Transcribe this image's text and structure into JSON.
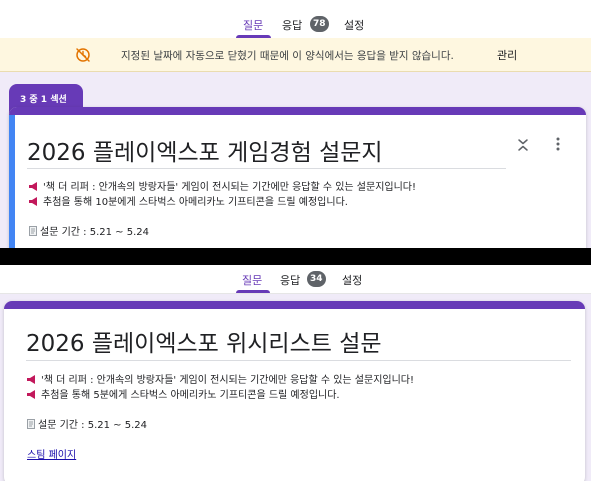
{
  "form1": {
    "tabs": {
      "questions": "질문",
      "responses": "응답",
      "responses_count": "78",
      "settings": "설정"
    },
    "notice": {
      "icon": "clock-off-icon",
      "text": "지정된 날짜에 자동으로 닫혔기 때문에 이 양식에서는 응답을 받지 않습니다.",
      "action": "관리"
    },
    "section_tab": "3 중 1 섹션",
    "title": "2026 플레이엑스포 게임경험 설문지",
    "description": [
      "'책 더 리퍼 : 안개속의 방랑자들' 게임이 전시되는 기간에만 응답할 수 있는 설문지입니다!",
      "추첨을 통해 10분에게 스타벅스 아메리카노 기프티콘을 드릴 예정입니다."
    ],
    "period": "설문 기간 : 5.21 ~ 5.24",
    "icons": {
      "collapse": "collapse-icon",
      "more": "more-vert-icon"
    }
  },
  "form2": {
    "tabs": {
      "questions": "질문",
      "responses": "응답",
      "responses_count": "34",
      "settings": "설정"
    },
    "title": "2026 플레이엑스포 위시리스트 설문",
    "description": [
      "'책 더 리퍼 : 안개속의 방랑자들' 게임이 전시되는 기간에만 응답할 수 있는 설문지입니다!",
      "추첨을 통해 5분에게 스타벅스 아메리카노 기프티콘을 드릴 예정입니다."
    ],
    "period": "설문 기간 : 5.21 ~ 5.24",
    "link": "스팀 페이지"
  },
  "colors": {
    "accent": "#673ab7",
    "background": "#f0ebf8",
    "notice_bg": "#fef7e0",
    "link": "#1a0dab",
    "badge": "#5f6368"
  }
}
